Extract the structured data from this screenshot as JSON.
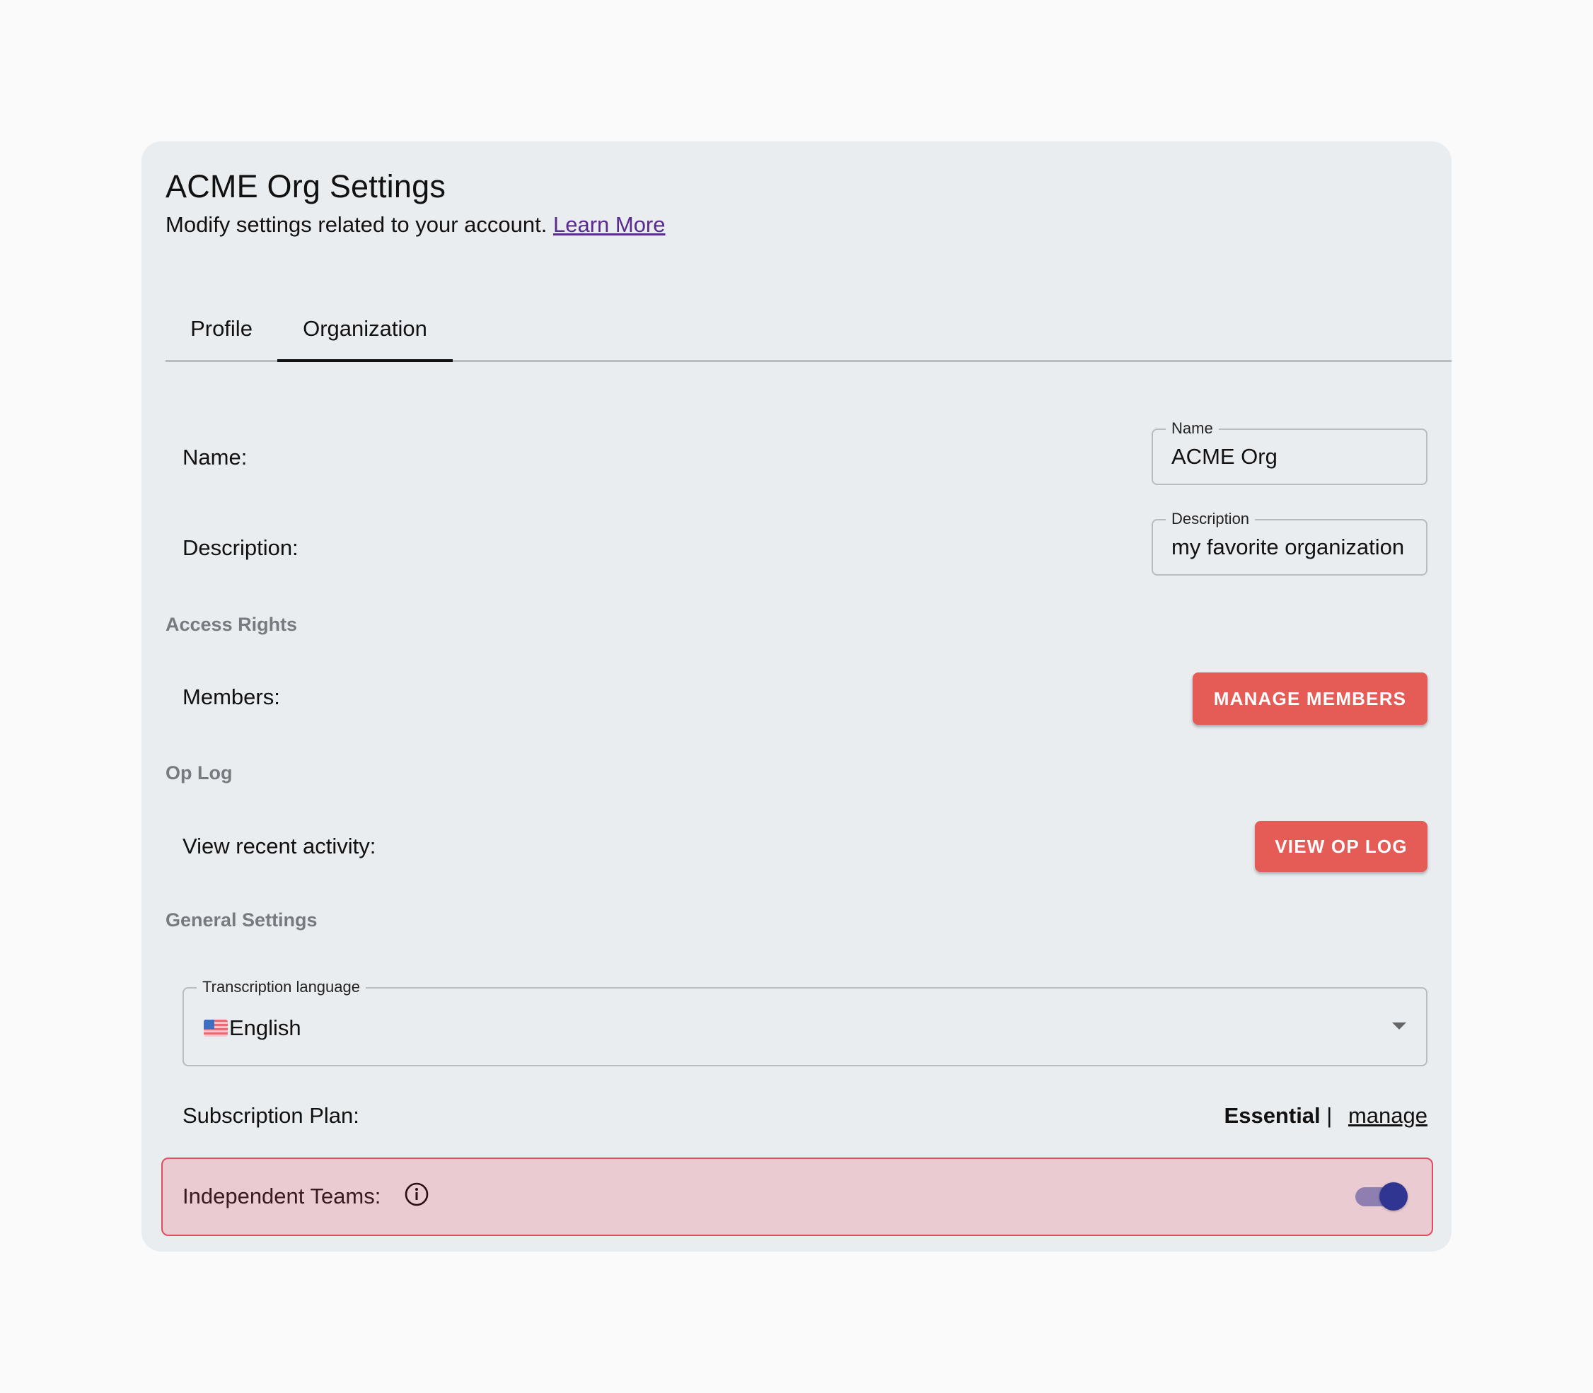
{
  "header": {
    "title": "ACME Org Settings",
    "subtitle": "Modify settings related to your account.",
    "learn_more": "Learn More"
  },
  "tabs": [
    {
      "label": "Profile",
      "active": false
    },
    {
      "label": "Organization",
      "active": true
    }
  ],
  "fields": {
    "name": {
      "row_label": "Name:",
      "field_label": "Name",
      "value": "ACME Org"
    },
    "description": {
      "row_label": "Description:",
      "field_label": "Description",
      "value": "my favorite organization"
    }
  },
  "sections": {
    "access_rights": {
      "heading": "Access Rights",
      "members_label": "Members:",
      "button": "MANAGE MEMBERS"
    },
    "op_log": {
      "heading": "Op Log",
      "activity_label": "View recent activity:",
      "button": "VIEW OP LOG"
    },
    "general": {
      "heading": "General Settings",
      "transcription": {
        "field_label": "Transcription language",
        "value": "English",
        "flag_icon": "us-flag-icon"
      },
      "subscription": {
        "label": "Subscription Plan:",
        "plan": "Essential",
        "separator": "|",
        "manage": "manage"
      },
      "independent_teams": {
        "label": "Independent Teams:",
        "info_icon": "info-icon",
        "enabled": true
      }
    }
  },
  "colors": {
    "accent_button": "#e55b56",
    "link": "#5b2a8f",
    "toggle_thumb": "#2f3590",
    "highlight_border": "#e24d5e",
    "highlight_bg": "#ebcbd2"
  }
}
